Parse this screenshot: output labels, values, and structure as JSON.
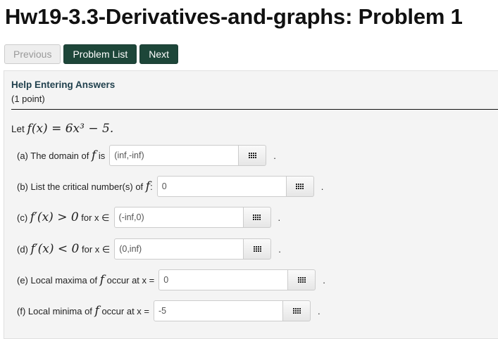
{
  "title": "Hw19-3.3-Derivatives-and-graphs: Problem 1",
  "nav": {
    "previous": "Previous",
    "problem_list": "Problem List",
    "next": "Next"
  },
  "help": "Help Entering Answers",
  "points": "(1 point)",
  "intro": {
    "prefix": "Let ",
    "math": "f(x) = 6x³ − 5."
  },
  "parts": [
    {
      "pre": "(a) The domain of ",
      "math": "f",
      "post": " is",
      "value": "(inf,-inf)"
    },
    {
      "pre": "(b) List the critical number(s) of ",
      "math": "f",
      "post": ":",
      "value": "0"
    },
    {
      "pre": "(c) ",
      "math": "f′(x) > 0",
      "post": " for x ∈",
      "value": "(-inf,0)"
    },
    {
      "pre": "(d) ",
      "math": "f′(x) < 0",
      "post": " for x ∈",
      "value": "(0,inf)"
    },
    {
      "pre": "(e) Local maxima of ",
      "math": "f",
      "post": " occur at x =",
      "value": "0"
    },
    {
      "pre": "(f) Local minima of ",
      "math": "f",
      "post": " occur at x =",
      "value": "-5"
    }
  ],
  "period": "."
}
